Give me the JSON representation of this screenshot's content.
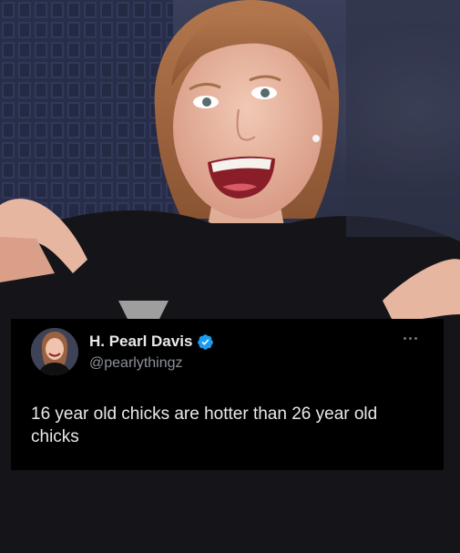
{
  "tweet": {
    "display_name": "H. Pearl Davis",
    "handle": "@pearlythingz",
    "text": "16 year old chicks are hotter than 26 year old chicks",
    "verified": true,
    "icons": {
      "verified": "verified-badge-icon",
      "more": "more-options-icon"
    }
  },
  "colors": {
    "tweet_background": "#000000",
    "name_text": "#e7e9ea",
    "handle_text": "#8b9096",
    "verified_badge": "#1d9bf0"
  }
}
